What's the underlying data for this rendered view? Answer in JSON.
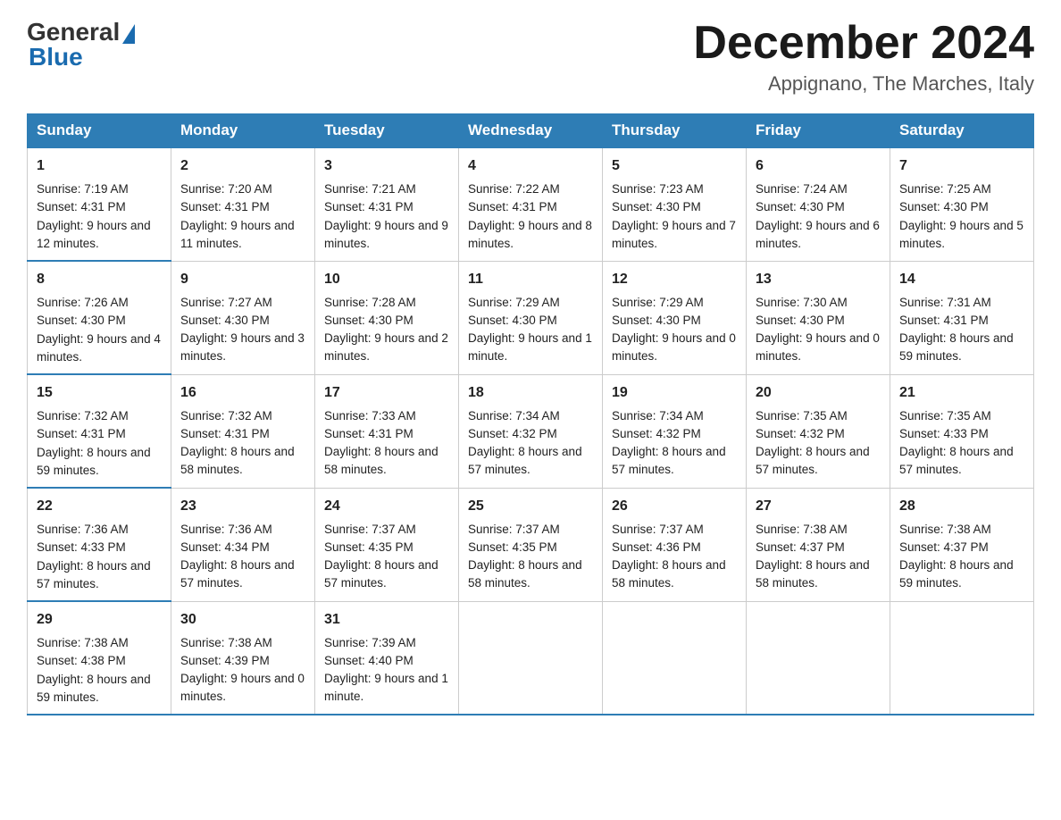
{
  "logo": {
    "general": "General",
    "blue": "Blue"
  },
  "title": "December 2024",
  "location": "Appignano, The Marches, Italy",
  "days_of_week": [
    "Sunday",
    "Monday",
    "Tuesday",
    "Wednesday",
    "Thursday",
    "Friday",
    "Saturday"
  ],
  "weeks": [
    [
      {
        "day": "1",
        "sunrise": "7:19 AM",
        "sunset": "4:31 PM",
        "daylight": "9 hours and 12 minutes."
      },
      {
        "day": "2",
        "sunrise": "7:20 AM",
        "sunset": "4:31 PM",
        "daylight": "9 hours and 11 minutes."
      },
      {
        "day": "3",
        "sunrise": "7:21 AM",
        "sunset": "4:31 PM",
        "daylight": "9 hours and 9 minutes."
      },
      {
        "day": "4",
        "sunrise": "7:22 AM",
        "sunset": "4:31 PM",
        "daylight": "9 hours and 8 minutes."
      },
      {
        "day": "5",
        "sunrise": "7:23 AM",
        "sunset": "4:30 PM",
        "daylight": "9 hours and 7 minutes."
      },
      {
        "day": "6",
        "sunrise": "7:24 AM",
        "sunset": "4:30 PM",
        "daylight": "9 hours and 6 minutes."
      },
      {
        "day": "7",
        "sunrise": "7:25 AM",
        "sunset": "4:30 PM",
        "daylight": "9 hours and 5 minutes."
      }
    ],
    [
      {
        "day": "8",
        "sunrise": "7:26 AM",
        "sunset": "4:30 PM",
        "daylight": "9 hours and 4 minutes."
      },
      {
        "day": "9",
        "sunrise": "7:27 AM",
        "sunset": "4:30 PM",
        "daylight": "9 hours and 3 minutes."
      },
      {
        "day": "10",
        "sunrise": "7:28 AM",
        "sunset": "4:30 PM",
        "daylight": "9 hours and 2 minutes."
      },
      {
        "day": "11",
        "sunrise": "7:29 AM",
        "sunset": "4:30 PM",
        "daylight": "9 hours and 1 minute."
      },
      {
        "day": "12",
        "sunrise": "7:29 AM",
        "sunset": "4:30 PM",
        "daylight": "9 hours and 0 minutes."
      },
      {
        "day": "13",
        "sunrise": "7:30 AM",
        "sunset": "4:30 PM",
        "daylight": "9 hours and 0 minutes."
      },
      {
        "day": "14",
        "sunrise": "7:31 AM",
        "sunset": "4:31 PM",
        "daylight": "8 hours and 59 minutes."
      }
    ],
    [
      {
        "day": "15",
        "sunrise": "7:32 AM",
        "sunset": "4:31 PM",
        "daylight": "8 hours and 59 minutes."
      },
      {
        "day": "16",
        "sunrise": "7:32 AM",
        "sunset": "4:31 PM",
        "daylight": "8 hours and 58 minutes."
      },
      {
        "day": "17",
        "sunrise": "7:33 AM",
        "sunset": "4:31 PM",
        "daylight": "8 hours and 58 minutes."
      },
      {
        "day": "18",
        "sunrise": "7:34 AM",
        "sunset": "4:32 PM",
        "daylight": "8 hours and 57 minutes."
      },
      {
        "day": "19",
        "sunrise": "7:34 AM",
        "sunset": "4:32 PM",
        "daylight": "8 hours and 57 minutes."
      },
      {
        "day": "20",
        "sunrise": "7:35 AM",
        "sunset": "4:32 PM",
        "daylight": "8 hours and 57 minutes."
      },
      {
        "day": "21",
        "sunrise": "7:35 AM",
        "sunset": "4:33 PM",
        "daylight": "8 hours and 57 minutes."
      }
    ],
    [
      {
        "day": "22",
        "sunrise": "7:36 AM",
        "sunset": "4:33 PM",
        "daylight": "8 hours and 57 minutes."
      },
      {
        "day": "23",
        "sunrise": "7:36 AM",
        "sunset": "4:34 PM",
        "daylight": "8 hours and 57 minutes."
      },
      {
        "day": "24",
        "sunrise": "7:37 AM",
        "sunset": "4:35 PM",
        "daylight": "8 hours and 57 minutes."
      },
      {
        "day": "25",
        "sunrise": "7:37 AM",
        "sunset": "4:35 PM",
        "daylight": "8 hours and 58 minutes."
      },
      {
        "day": "26",
        "sunrise": "7:37 AM",
        "sunset": "4:36 PM",
        "daylight": "8 hours and 58 minutes."
      },
      {
        "day": "27",
        "sunrise": "7:38 AM",
        "sunset": "4:37 PM",
        "daylight": "8 hours and 58 minutes."
      },
      {
        "day": "28",
        "sunrise": "7:38 AM",
        "sunset": "4:37 PM",
        "daylight": "8 hours and 59 minutes."
      }
    ],
    [
      {
        "day": "29",
        "sunrise": "7:38 AM",
        "sunset": "4:38 PM",
        "daylight": "8 hours and 59 minutes."
      },
      {
        "day": "30",
        "sunrise": "7:38 AM",
        "sunset": "4:39 PM",
        "daylight": "9 hours and 0 minutes."
      },
      {
        "day": "31",
        "sunrise": "7:39 AM",
        "sunset": "4:40 PM",
        "daylight": "9 hours and 1 minute."
      },
      null,
      null,
      null,
      null
    ]
  ]
}
